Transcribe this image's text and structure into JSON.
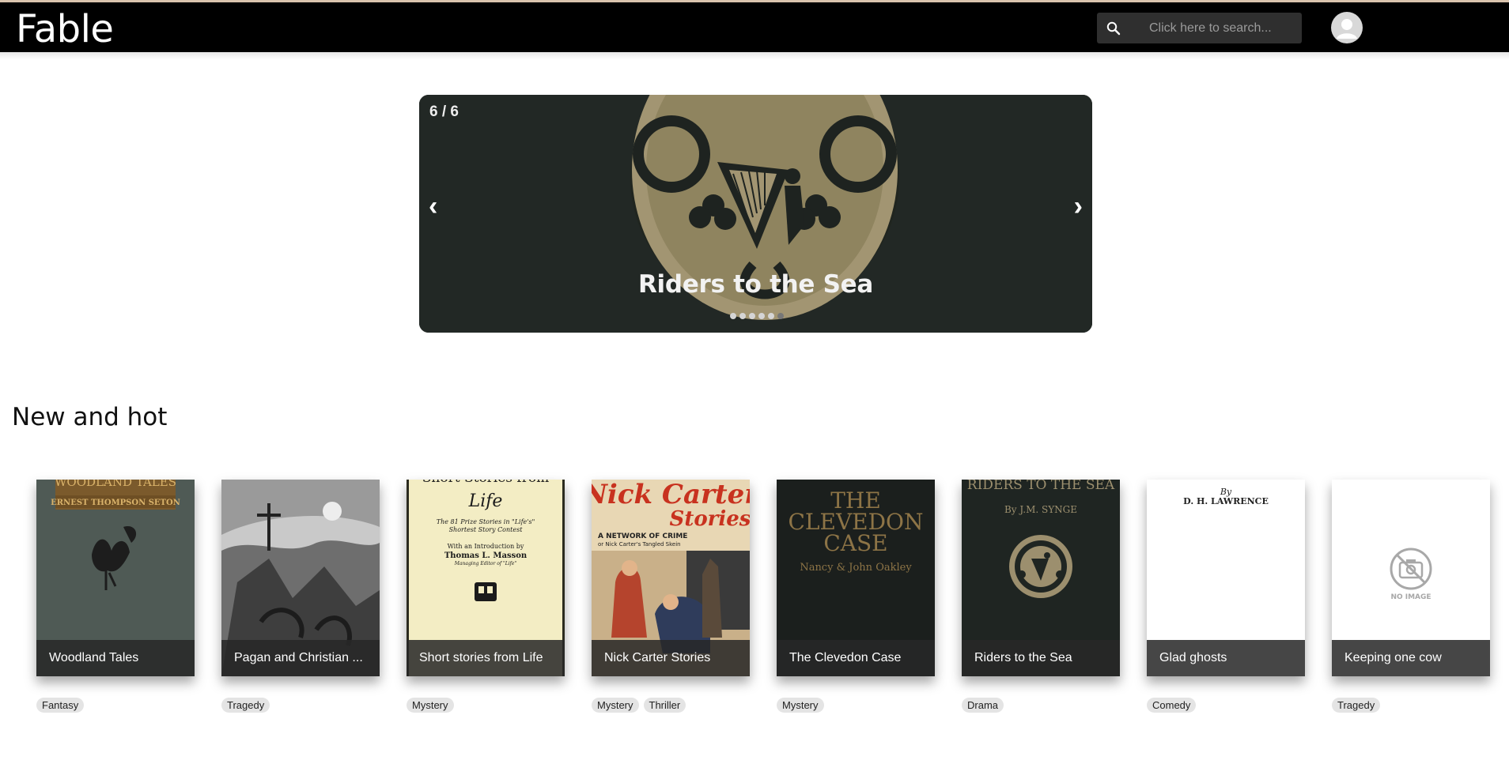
{
  "app": {
    "logo": "Fable"
  },
  "header": {
    "search_placeholder": "Click here to search..."
  },
  "carousel": {
    "counter": "6 / 6",
    "prev_label": "‹",
    "next_label": "›",
    "slide_title": "Riders to the Sea",
    "slide_count": 6,
    "active_index": 5
  },
  "section": {
    "title": "New and hot"
  },
  "books": [
    {
      "title": "Woodland Tales",
      "tags": [
        "Fantasy"
      ]
    },
    {
      "title": "Pagan and Christian ...",
      "tags": [
        "Tragedy"
      ]
    },
    {
      "title": "Short stories from Life",
      "tags": [
        "Mystery"
      ]
    },
    {
      "title": "Nick Carter Stories",
      "tags": [
        "Mystery",
        "Thriller"
      ]
    },
    {
      "title": "The Clevedon Case",
      "tags": [
        "Mystery"
      ]
    },
    {
      "title": "Riders to the Sea",
      "tags": [
        "Drama"
      ]
    },
    {
      "title": "Glad ghosts",
      "tags": [
        "Comedy"
      ]
    },
    {
      "title": "Keeping one cow",
      "tags": [
        "Tragedy"
      ]
    }
  ],
  "covers": {
    "woodland": {
      "line1": "WOODLAND TALES",
      "line2": "ERNEST THOMPSON SETON"
    },
    "life": {
      "line1": "Short Stories from",
      "line2": "Life",
      "line3": "The 81 Prize Stories in \"Life's\"",
      "line4": "Shortest Story Contest",
      "line5": "With an Introduction by",
      "line6": "Thomas L. Masson",
      "line7": "Managing Editor of \"Life\""
    },
    "nick": {
      "line1": "Nick Carter",
      "line2": "Stories",
      "line3": "A NETWORK OF CRIME",
      "line4": "or Nick Carter's Tangled Skein"
    },
    "clevedon": {
      "line1": "THE",
      "line2": "CLEVEDON",
      "line3": "CASE",
      "line4": "Nancy & John Oakley"
    },
    "riders": {
      "line1": "RIDERS TO THE SEA",
      "line2": "By J.M. SYNGE"
    },
    "glad": {
      "line1": "By",
      "line2": "D. H. LAWRENCE"
    },
    "cow": {
      "no_image": "NO IMAGE"
    }
  },
  "colors": {
    "navbar": "#000000",
    "caption_bg": "#282828",
    "tag_bg": "#e4e4e4"
  }
}
